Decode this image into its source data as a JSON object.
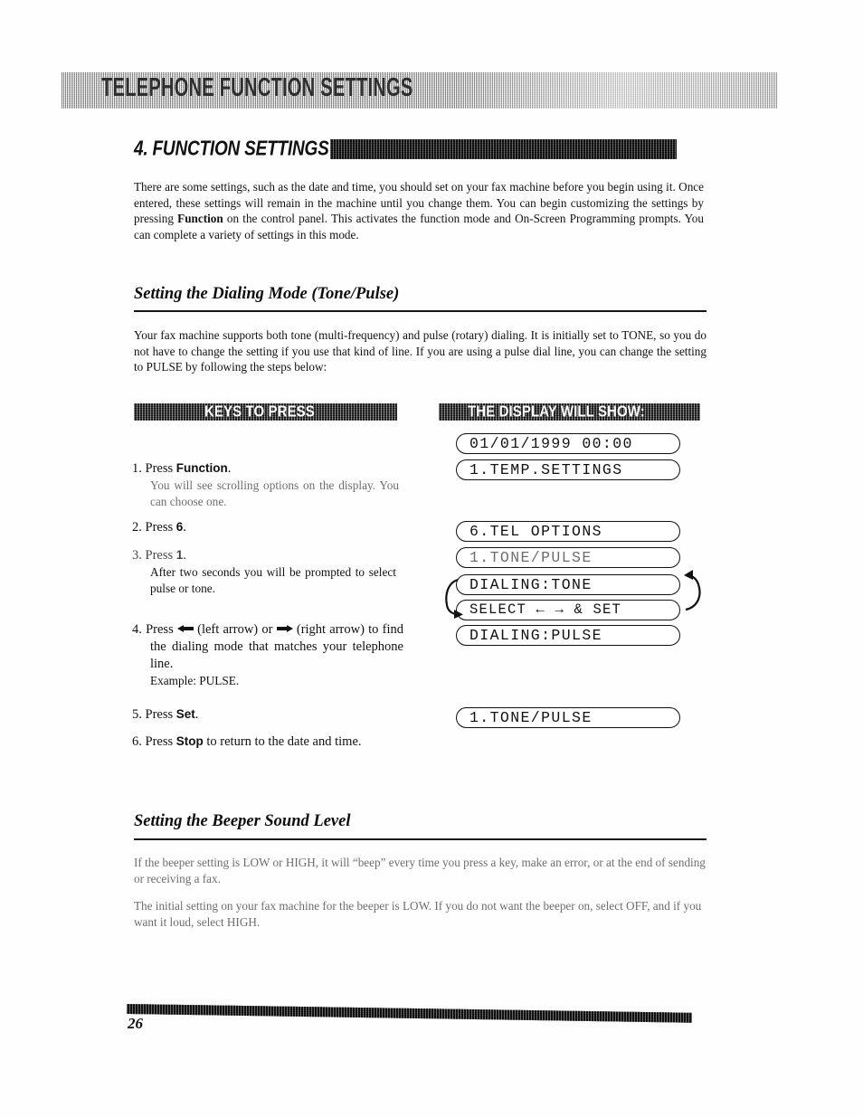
{
  "page": {
    "running_header": "TELEPHONE FUNCTION SETTINGS",
    "page_number": "26"
  },
  "chapter": {
    "title": "4. FUNCTION SETTINGS"
  },
  "intro": {
    "text_part1": "There are some settings, such as the date and time, you should set on your fax machine before you begin using it. Once entered, these settings will remain in the machine until you change them. You can begin customizing the settings by pressing ",
    "bold_term": "Function",
    "text_part2": " on the control panel. This activates the function mode and On-Screen Programming prompts. You can complete a variety of settings in this mode."
  },
  "section_dialing": {
    "heading": "Setting the Dialing Mode (Tone/Pulse)",
    "paragraph": "Your fax machine supports both tone (multi-frequency) and pulse (rotary) dialing. It is initially set to TONE, so you do not have to change the setting if you use that kind of line. If you are using a pulse dial line, you can change the setting to PULSE by following the steps below:"
  },
  "columns": {
    "keys_header": "KEYS TO PRESS",
    "display_header": "THE DISPLAY WILL SHOW:"
  },
  "steps": [
    {
      "number": "1.",
      "lead": "Press ",
      "key": "Function",
      "tail": ".",
      "sub": "You will see scrolling options on the display. You can choose one."
    },
    {
      "number": "2.",
      "lead": "Press ",
      "key": "6",
      "tail": ".",
      "sub": ""
    },
    {
      "number": "3.",
      "lead": "Press ",
      "key": "1",
      "tail": ".",
      "sub": "After two seconds you will be prompted to select pulse or tone."
    },
    {
      "number": "4.",
      "lead": "Press ",
      "key": "",
      "tail": "",
      "sub": "Example: PULSE.",
      "body_a": "Press ",
      "body_b": " (left arrow) or ",
      "body_c": " (right arrow) to find the dialing mode that matches your telephone line."
    },
    {
      "number": "5.",
      "lead": "Press ",
      "key": "Set",
      "tail": ".",
      "sub": ""
    },
    {
      "number": "6.",
      "lead": "Press ",
      "key": "Stop",
      "tail": " to return to the date and time.",
      "sub": ""
    }
  ],
  "displays": {
    "group1": [
      "01/01/1999 00:00",
      "1.TEMP.SETTINGS"
    ],
    "group2": [
      "6.TEL OPTIONS",
      "1.TONE/PULSE",
      "DIALING:TONE",
      "SELECT ← → & SET",
      "DIALING:PULSE"
    ],
    "group3": [
      "1.TONE/PULSE"
    ]
  },
  "section_beeper": {
    "heading": "Setting the Beeper Sound Level",
    "paragraph1": "If the beeper setting is LOW or HIGH, it will “beep” every time you press a key, make an error, or at the end of sending or receiving a fax.",
    "paragraph2": "The initial setting on your fax machine for the beeper is LOW. If you do not want the beeper on, select OFF, and if you want it loud, select HIGH."
  }
}
